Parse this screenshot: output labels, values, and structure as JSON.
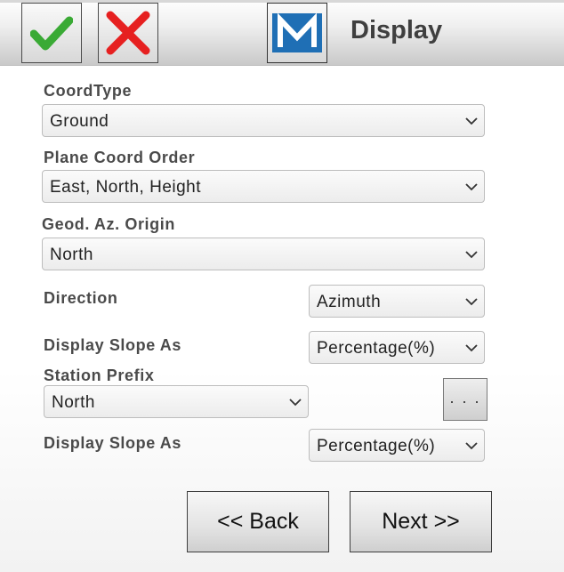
{
  "header": {
    "title": "Display",
    "ok_icon": "checkmark-icon",
    "cancel_icon": "close-icon",
    "app_icon": "app-logo-m-icon",
    "accept_color": "#3aaa35",
    "cancel_color": "#e62020",
    "logo_color": "#1f6fb5"
  },
  "form": {
    "coord_type": {
      "label": "CoordType",
      "value": "Ground"
    },
    "plane_coord_order": {
      "label": "Plane Coord Order",
      "value": "East, North, Height"
    },
    "geod_az_origin": {
      "label": "Geod. Az. Origin",
      "value": "North"
    },
    "direction": {
      "label": "Direction",
      "value": "Azimuth"
    },
    "display_slope_1": {
      "label": "Display Slope As",
      "value": "Percentage(%)"
    },
    "station_prefix": {
      "label": "Station Prefix",
      "value": "North",
      "more_label": ". . ."
    },
    "display_slope_2": {
      "label": "Display Slope As",
      "value": "Percentage(%)"
    }
  },
  "footer": {
    "back_label": "<< Back",
    "next_label": "Next >>"
  }
}
